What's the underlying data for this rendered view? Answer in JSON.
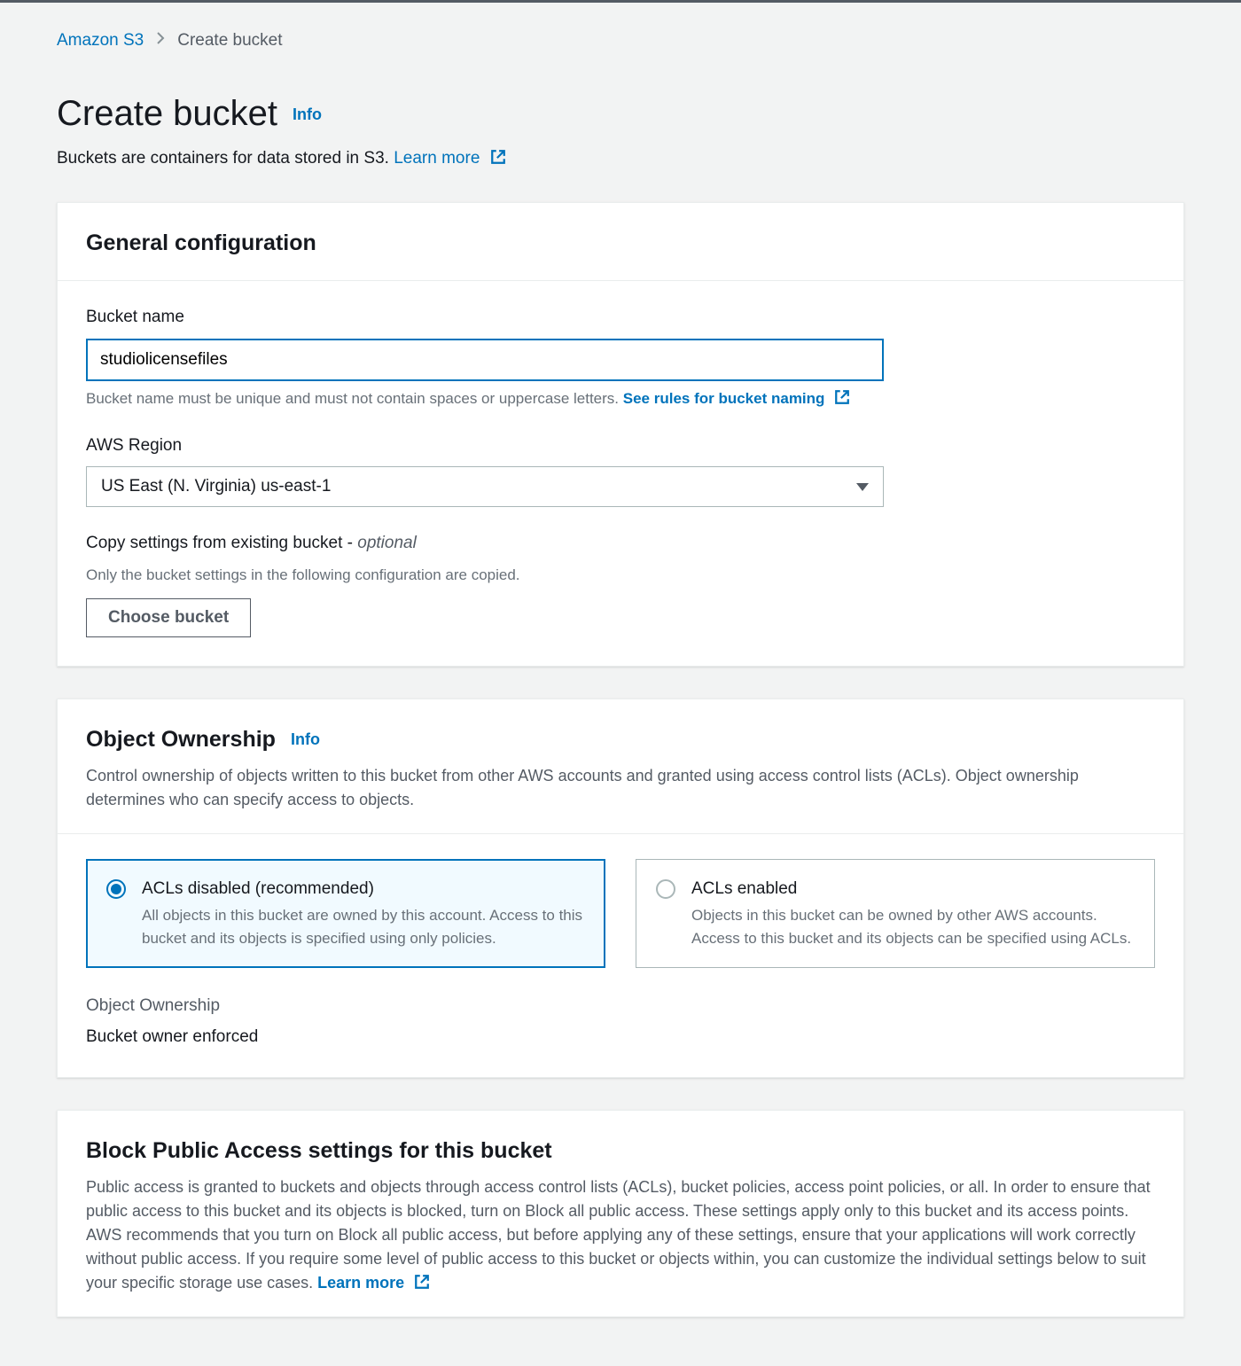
{
  "breadcrumb": {
    "root": "Amazon S3",
    "current": "Create bucket"
  },
  "header": {
    "title": "Create bucket",
    "info": "Info",
    "subtitle": "Buckets are containers for data stored in S3.",
    "learn_more": "Learn more"
  },
  "general": {
    "heading": "General configuration",
    "bucket_name": {
      "label": "Bucket name",
      "value": "studiolicensefiles",
      "hint_text": "Bucket name must be unique and must not contain spaces or uppercase letters.",
      "hint_link": "See rules for bucket naming"
    },
    "region": {
      "label": "AWS Region",
      "value": "US East (N. Virginia) us-east-1"
    },
    "copy": {
      "label_main": "Copy settings from existing bucket -",
      "label_optional": "optional",
      "hint": "Only the bucket settings in the following configuration are copied.",
      "button": "Choose bucket"
    }
  },
  "ownership": {
    "heading": "Object Ownership",
    "info": "Info",
    "desc": "Control ownership of objects written to this bucket from other AWS accounts and granted using access control lists (ACLs). Object ownership determines who can specify access to objects.",
    "option_disabled": {
      "title": "ACLs disabled (recommended)",
      "desc": "All objects in this bucket are owned by this account. Access to this bucket and its objects is specified using only policies."
    },
    "option_enabled": {
      "title": "ACLs enabled",
      "desc": "Objects in this bucket can be owned by other AWS accounts. Access to this bucket and its objects can be specified using ACLs."
    },
    "summary_label": "Object Ownership",
    "summary_value": "Bucket owner enforced"
  },
  "public_access": {
    "heading": "Block Public Access settings for this bucket",
    "desc": "Public access is granted to buckets and objects through access control lists (ACLs), bucket policies, access point policies, or all. In order to ensure that public access to this bucket and its objects is blocked, turn on Block all public access. These settings apply only to this bucket and its access points. AWS recommends that you turn on Block all public access, but before applying any of these settings, ensure that your applications will work correctly without public access. If you require some level of public access to this bucket or objects within, you can customize the individual settings below to suit your specific storage use cases.",
    "learn_more": "Learn more"
  }
}
